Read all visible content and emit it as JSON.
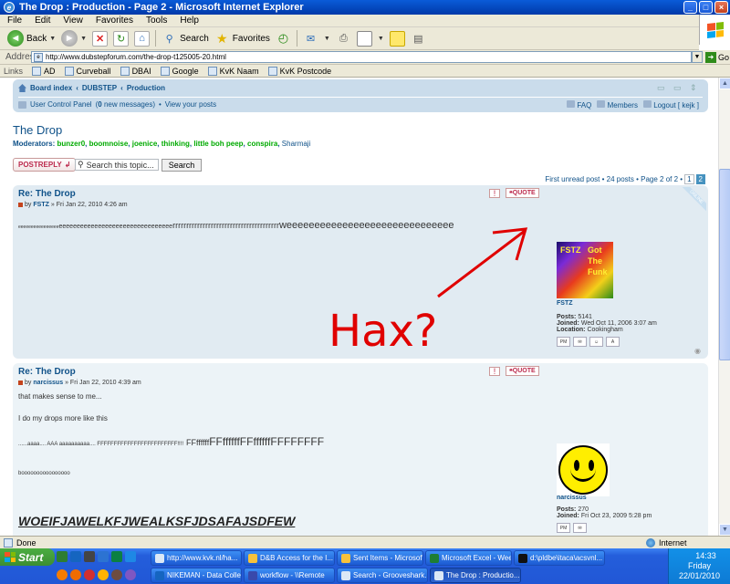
{
  "window": {
    "title": "The Drop : Production - Page 2 - Microsoft Internet Explorer",
    "buttons": {
      "minimize": "_",
      "maximize": "□",
      "close": "×"
    }
  },
  "menu": [
    "File",
    "Edit",
    "View",
    "Favorites",
    "Tools",
    "Help"
  ],
  "toolbar": {
    "back": "Back",
    "search": "Search",
    "favorites": "Favorites"
  },
  "address": {
    "label": "Address",
    "url": "http://www.dubstepforum.com/the-drop-t125005-20.html",
    "go": "Go"
  },
  "links": {
    "label": "Links",
    "items": [
      "AD",
      "Curveball",
      "DBAI",
      "Google",
      "KvK Naam",
      "KvK Postcode"
    ]
  },
  "forum_nav": {
    "breadcrumb": [
      "Board index",
      "DUBSTEP",
      "Production"
    ],
    "separator": "‹",
    "user_cp": "User Control Panel",
    "new_messages_count": "0",
    "new_messages_label": "new messages",
    "view_posts": "View your posts",
    "faq": "FAQ",
    "members": "Members",
    "logout": "Logout [ kejk ]"
  },
  "topic": {
    "title": "The Drop",
    "moderators_label": "Moderators:",
    "moderators": [
      "bunzer0",
      "boomnoise",
      "joenice",
      "thinking",
      "little boh peep",
      "conspira"
    ],
    "moderators_plain": "Sharmaji",
    "postreply": "POSTREPLY",
    "search_placeholder": "Search this topic...",
    "search_button": "Search",
    "pagination_text": "First unread post • 24 posts • Page 2 of 2 •",
    "pages": [
      "1",
      "2"
    ]
  },
  "posts": [
    {
      "title": "Re: The Drop",
      "by": "by",
      "author": "FSTZ",
      "date": "» Fri Jan 22, 2010 4:26 am",
      "quote": "QUOTE",
      "online": "ONLINE",
      "content": {
        "d1": "eeeeeeeeeeeeeeee",
        "d2": "eeeeeeeeeeeeeeeeeeeeeeeeeeeeeeee",
        "d3": "rrrrrrrrrrrrrrrrrrrrrrrrrrrrrrrrrrrrrrr",
        "d4": "weeeeeeeeeeeeeeeeeeeeeeeeeeeeee"
      },
      "annotation": "Hax?",
      "avatar_text": [
        "FSTZ",
        "Got",
        "The",
        "Funk"
      ],
      "profile": {
        "name": "FSTZ",
        "posts_label": "Posts:",
        "posts": "5141",
        "joined_label": "Joined:",
        "joined": "Wed Oct 11, 2006 3:07 am",
        "location_label": "Location:",
        "location": "Cookingham"
      }
    },
    {
      "title": "Re: The Drop",
      "by": "by",
      "author": "narcissus",
      "date": "» Fri Jan 22, 2010 4:39 am",
      "quote": "QUOTE",
      "lines": [
        "that makes sense to me...",
        "I do my drops more like this"
      ],
      "drops": {
        "a": "......aaaa.... AAA aaaaaaaaaa.... FFFFFFFFFFFFFFFFFFFFFFFF!!!!",
        "b": "FFffffff",
        "c": "FFffffffFFffffffFFFFFFFF"
      },
      "booo": "boooooooooooooooo",
      "shout": "WOEIFJAWELKFJWEALKSFJDSAFAJSDFEW",
      "profile": {
        "name": "narcissus",
        "posts_label": "Posts:",
        "posts": "270",
        "joined_label": "Joined:",
        "joined": "Fri Oct 23, 2009 5:28 pm"
      }
    }
  ],
  "status": {
    "text": "Done",
    "zone": "Internet"
  },
  "taskbar": {
    "start": "Start",
    "tasks_row1": [
      "http://www.kvk.nl/ha...",
      "D&B Access for the I...",
      "Sent Items - Microsof...",
      "Microsoft Excel - Wee...",
      "d:\\pldbe\\itaca\\acsvnl..."
    ],
    "tasks_row2": [
      "NIKEMAN - Data Colle...",
      "workflow - \\\\Remote",
      "Search - Grooveshark...",
      "The Drop : Productio..."
    ],
    "clock": {
      "time": "14:33",
      "day": "Friday",
      "date": "22/01/2010"
    }
  }
}
